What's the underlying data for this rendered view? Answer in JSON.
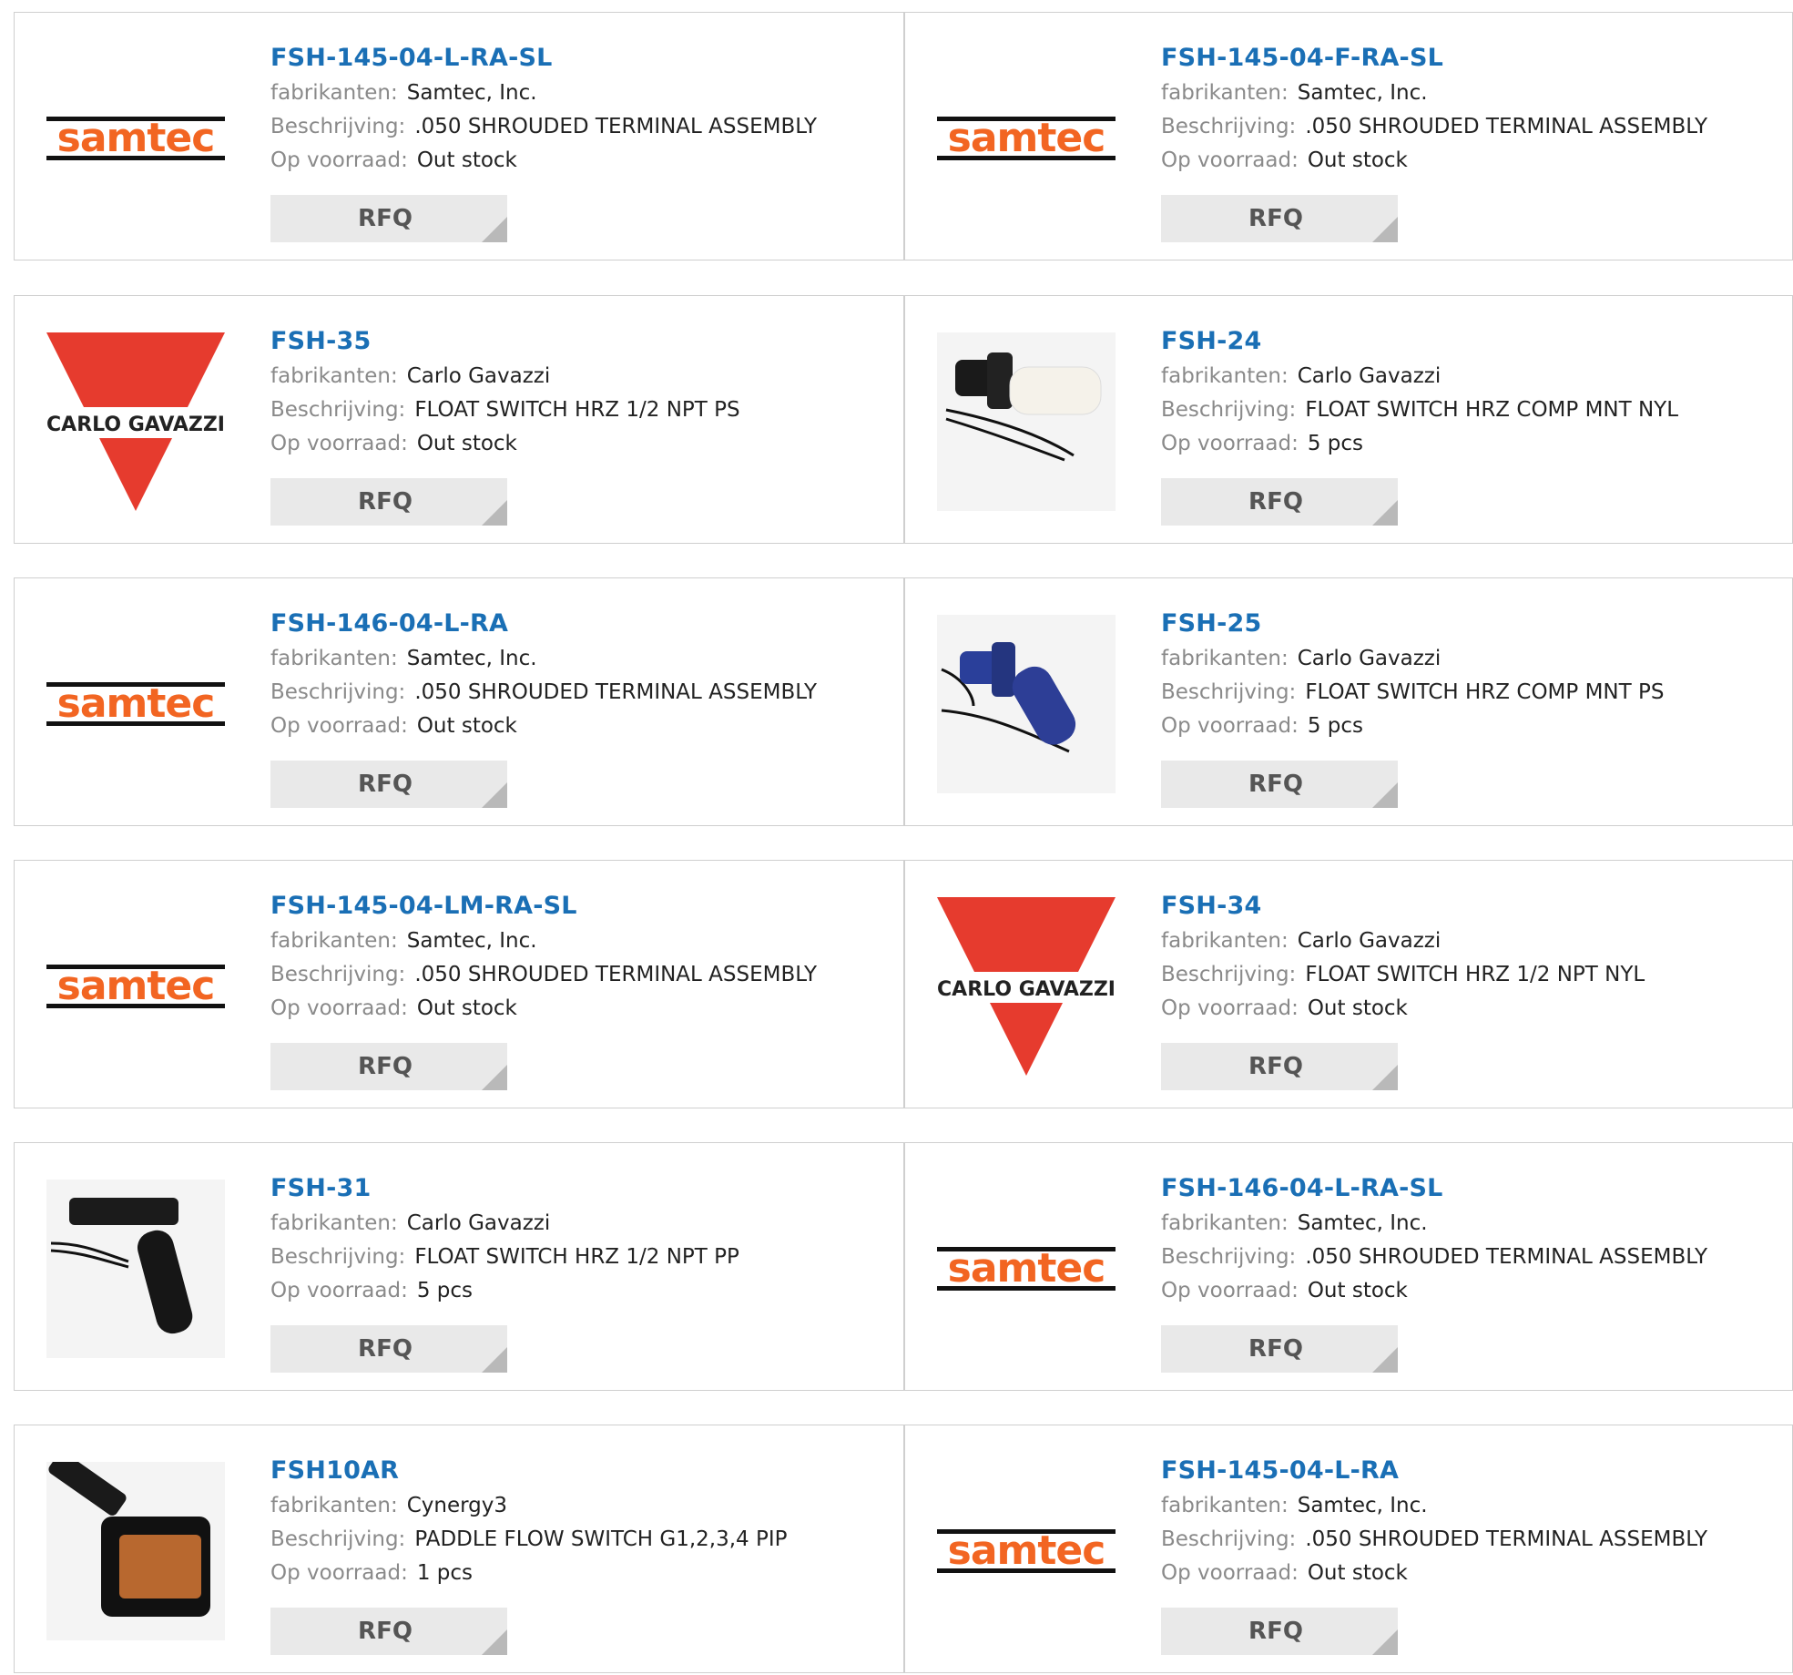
{
  "labels": {
    "manufacturer": "fabrikanten:",
    "description": "Beschrijving:",
    "stock": "Op voorraad:",
    "rfq": "RFQ"
  },
  "colors": {
    "part_link": "#1a6fb5",
    "samtec_orange": "#f26522",
    "carlo_red": "#e63b2e",
    "rfq_bg": "#e9e9e9"
  },
  "products": [
    {
      "part": "FSH-145-04-L-RA-SL",
      "manufacturer": "Samtec, Inc.",
      "description": ".050 SHROUDED TERMINAL ASSEMBLY",
      "stock": "Out stock",
      "image": "samtec-logo"
    },
    {
      "part": "FSH-145-04-F-RA-SL",
      "manufacturer": "Samtec, Inc.",
      "description": ".050 SHROUDED TERMINAL ASSEMBLY",
      "stock": "Out stock",
      "image": "samtec-logo"
    },
    {
      "part": "FSH-35",
      "manufacturer": "Carlo Gavazzi",
      "description": "FLOAT SWITCH HRZ 1/2 NPT PS",
      "stock": "Out stock",
      "image": "carlo-gavazzi-logo"
    },
    {
      "part": "FSH-24",
      "manufacturer": "Carlo Gavazzi",
      "description": "FLOAT SWITCH HRZ COMP MNT NYL",
      "stock": "5 pcs",
      "image": "float-switch-white"
    },
    {
      "part": "FSH-146-04-L-RA",
      "manufacturer": "Samtec, Inc.",
      "description": ".050 SHROUDED TERMINAL ASSEMBLY",
      "stock": "Out stock",
      "image": "samtec-logo"
    },
    {
      "part": "FSH-25",
      "manufacturer": "Carlo Gavazzi",
      "description": "FLOAT SWITCH HRZ COMP MNT PS",
      "stock": "5 pcs",
      "image": "float-switch-blue"
    },
    {
      "part": "FSH-145-04-LM-RA-SL",
      "manufacturer": "Samtec, Inc.",
      "description": ".050 SHROUDED TERMINAL ASSEMBLY",
      "stock": "Out stock",
      "image": "samtec-logo"
    },
    {
      "part": "FSH-34",
      "manufacturer": "Carlo Gavazzi",
      "description": "FLOAT SWITCH HRZ 1/2 NPT NYL",
      "stock": "Out stock",
      "image": "carlo-gavazzi-logo"
    },
    {
      "part": "FSH-31",
      "manufacturer": "Carlo Gavazzi",
      "description": "FLOAT SWITCH HRZ 1/2 NPT PP",
      "stock": "5 pcs",
      "image": "float-switch-black"
    },
    {
      "part": "FSH-146-04-L-RA-SL",
      "manufacturer": "Samtec, Inc.",
      "description": ".050 SHROUDED TERMINAL ASSEMBLY",
      "stock": "Out stock",
      "image": "samtec-logo"
    },
    {
      "part": "FSH10AR",
      "manufacturer": "Cynergy3",
      "description": "PADDLE FLOW SWITCH G1,2,3,4 PIP",
      "stock": "1 pcs",
      "image": "paddle-flow-switch"
    },
    {
      "part": "FSH-145-04-L-RA",
      "manufacturer": "Samtec, Inc.",
      "description": ".050 SHROUDED TERMINAL ASSEMBLY",
      "stock": "Out stock",
      "image": "samtec-logo"
    }
  ],
  "logos": {
    "samtec": "samtec",
    "carlo_gavazzi": "CARLO GAVAZZI"
  }
}
